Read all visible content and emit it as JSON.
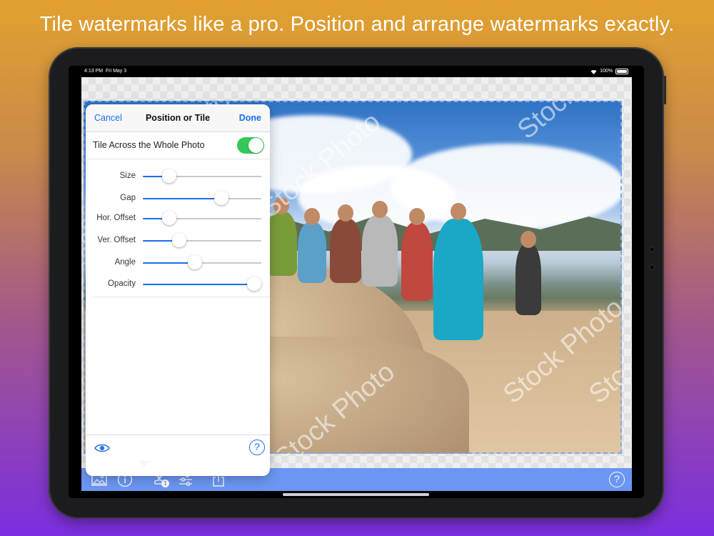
{
  "headline": "Tile watermarks like a pro. Position and arrange watermarks exactly.",
  "status_bar": {
    "time": "4:13 PM",
    "date": "Fri May 3",
    "battery": "100%"
  },
  "watermark_text": "Stock Photo",
  "popover": {
    "cancel_label": "Cancel",
    "title": "Position or Tile",
    "done_label": "Done",
    "toggle": {
      "label": "Tile Across the Whole Photo",
      "on": true
    },
    "sliders": [
      {
        "label": "Size",
        "value": 0.22
      },
      {
        "label": "Gap",
        "value": 0.66
      },
      {
        "label": "Hor. Offset",
        "value": 0.22
      },
      {
        "label": "Ver. Offset",
        "value": 0.31
      },
      {
        "label": "Angle",
        "value": 0.44
      },
      {
        "label": "Opacity",
        "value": 0.94
      }
    ],
    "footer": {
      "preview_icon": "eye-icon",
      "help_label": "?"
    }
  },
  "toolbar": {
    "items": [
      "photo-icon",
      "info-icon",
      "stamp-icon",
      "adjust-icon",
      "share-icon"
    ],
    "stamp_badge": "1",
    "help_label": "?"
  },
  "colors": {
    "accent": "#1a6ef0",
    "toggle_on": "#34c759",
    "toolbar": "#6b96f2",
    "frame": "#7ea8f2"
  }
}
